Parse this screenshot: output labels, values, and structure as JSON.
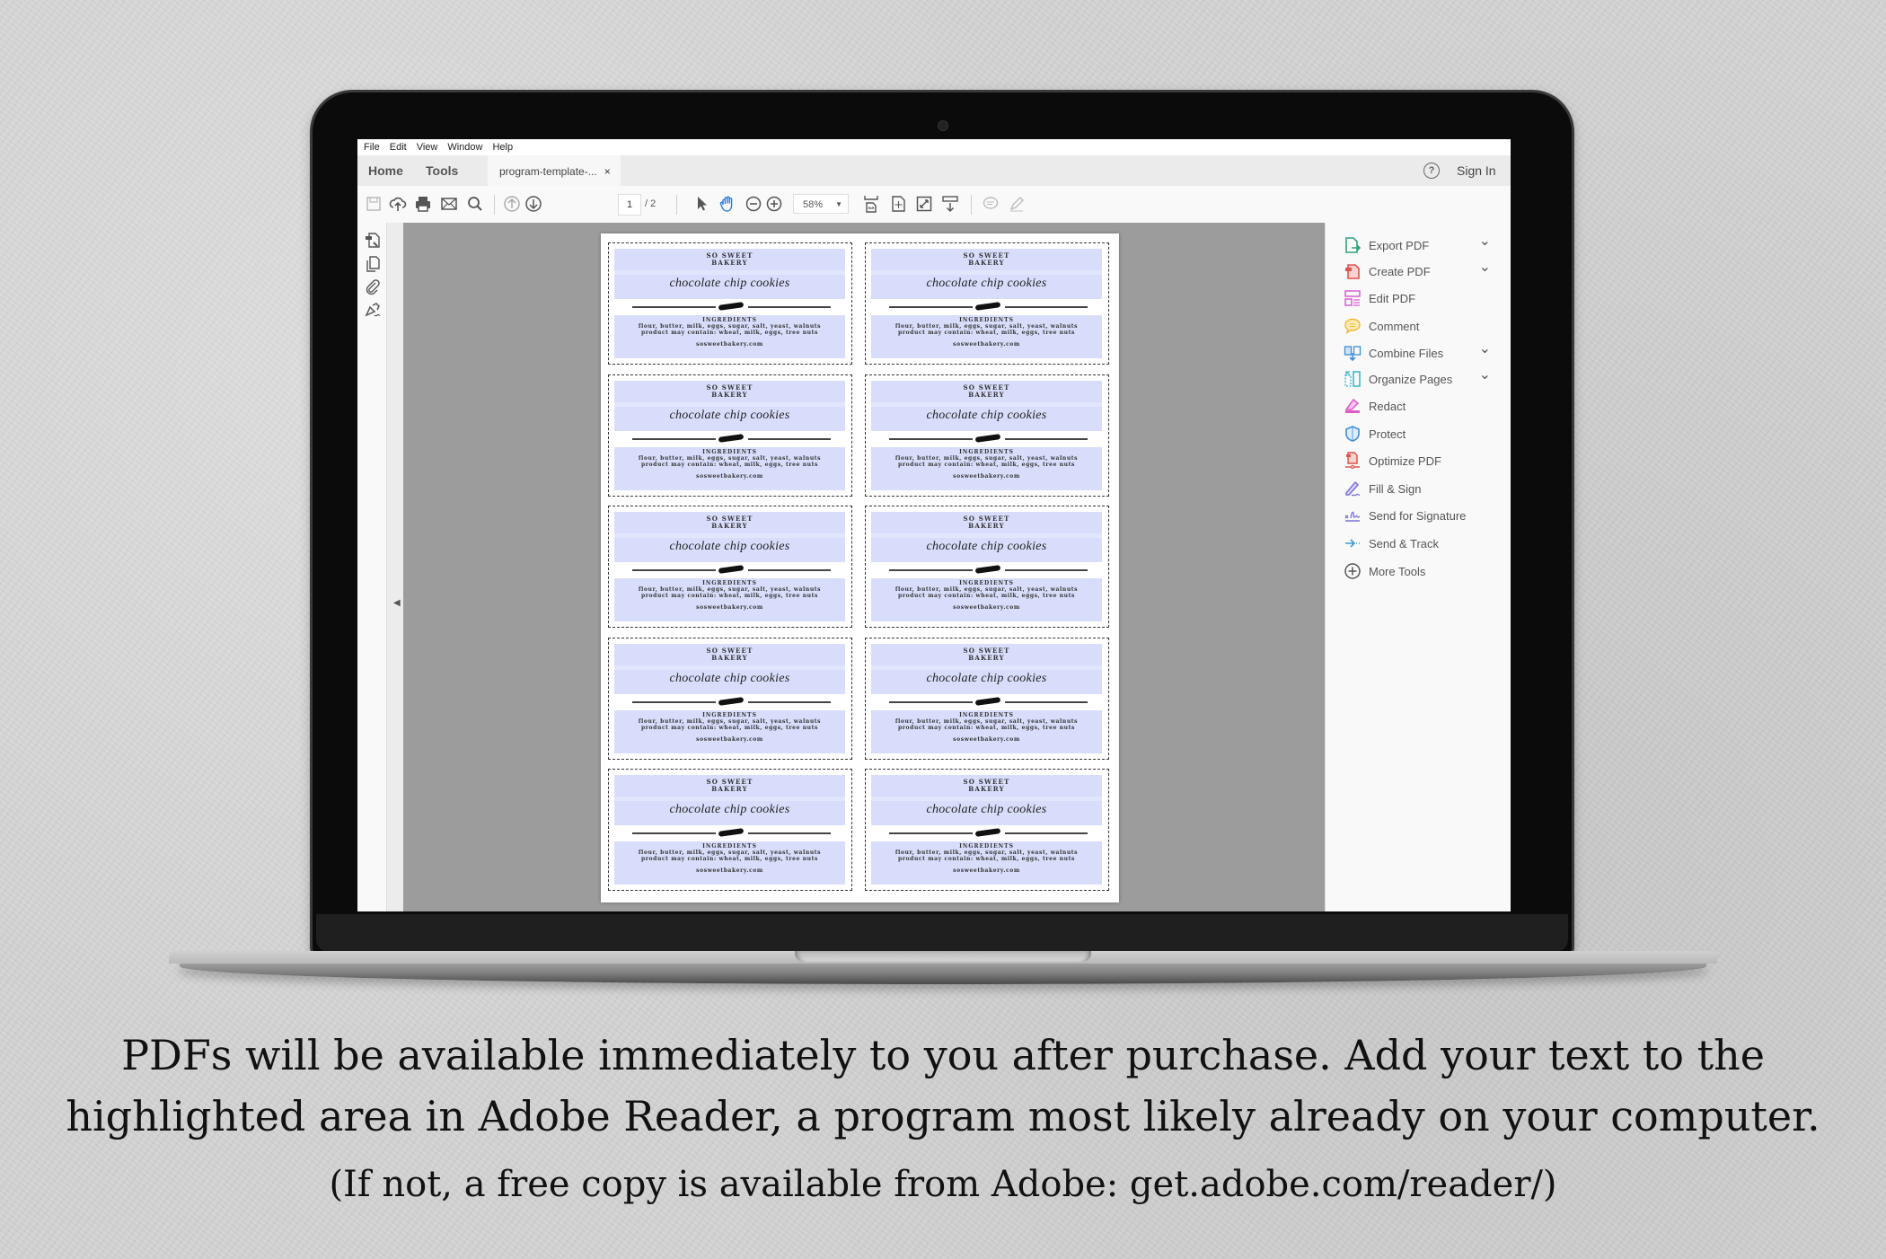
{
  "app": {
    "menu": [
      "File",
      "Edit",
      "View",
      "Window",
      "Help"
    ],
    "nav_tabs": {
      "home": "Home",
      "tools": "Tools"
    },
    "document_tab": {
      "title": "program-template-...",
      "close": "×"
    },
    "help_icon": "?",
    "sign_in": "Sign In"
  },
  "toolbar": {
    "icons": [
      "save-icon",
      "upload-cloud-icon",
      "print-icon",
      "email-icon",
      "search-icon",
      "page-up-icon",
      "page-down-icon",
      "select-cursor-icon",
      "hand-tool-icon",
      "zoom-out-icon",
      "zoom-in-icon",
      "fit-width-icon",
      "fit-page-icon",
      "full-screen-icon",
      "scroll-mode-icon",
      "comment-icon",
      "highlight-pen-icon"
    ],
    "current_page": "1",
    "total_pages": "/ 2",
    "zoom": "58%"
  },
  "left_rail": {
    "icons": [
      "page-thumbnails-icon",
      "copy-pages-icon",
      "attachment-icon",
      "signature-pen-icon"
    ]
  },
  "tools_panel": {
    "items": [
      {
        "label": "Export PDF",
        "icon": "export-pdf-icon",
        "color": "#2fa37b",
        "expandable": true
      },
      {
        "label": "Create PDF",
        "icon": "create-pdf-icon",
        "color": "#e0524c",
        "expandable": true
      },
      {
        "label": "Edit PDF",
        "icon": "edit-pdf-icon",
        "color": "#d660d1",
        "expandable": false
      },
      {
        "label": "Comment",
        "icon": "comment-icon",
        "color": "#f2b62e",
        "expandable": false
      },
      {
        "label": "Combine Files",
        "icon": "combine-files-icon",
        "color": "#3d8fd6",
        "expandable": true
      },
      {
        "label": "Organize Pages",
        "icon": "organize-pages-icon",
        "color": "#37b6c9",
        "expandable": true
      },
      {
        "label": "Redact",
        "icon": "redact-icon",
        "color": "#e05ac8",
        "expandable": false
      },
      {
        "label": "Protect",
        "icon": "protect-shield-icon",
        "color": "#3d8fd6",
        "expandable": false
      },
      {
        "label": "Optimize PDF",
        "icon": "optimize-pdf-icon",
        "color": "#e0524c",
        "expandable": false
      },
      {
        "label": "Fill & Sign",
        "icon": "fill-sign-icon",
        "color": "#7a6fe0",
        "expandable": false
      },
      {
        "label": "Send for Signature",
        "icon": "send-signature-icon",
        "color": "#7a6fe0",
        "expandable": false
      },
      {
        "label": "Send & Track",
        "icon": "send-track-icon",
        "color": "#3d9ad6",
        "expandable": false
      },
      {
        "label": "More Tools",
        "icon": "more-tools-icon",
        "color": "#555555",
        "expandable": false
      }
    ]
  },
  "pdf_label": {
    "brand_line1": "SO SWEET",
    "brand_line2": "BAKERY",
    "product": "chocolate chip cookies",
    "ingredients_heading": "INGREDIENTS",
    "ingredients": "flour, butter, milk, eggs, sugar, salt, yeast, walnuts",
    "allergens": "product may contain: wheat, milk, eggs, tree nuts",
    "website": "sosweetbakery.com",
    "highlight_color": "#d7ddfb",
    "count": 10
  },
  "caption": {
    "line1": "PDFs will be available immediately to you after purchase.  Add your text to the",
    "line2": "highlighted area in Adobe Reader, a program most likely already on your computer.",
    "line3": "(If not, a free copy is available from Adobe: get.adobe.com/reader/)"
  }
}
